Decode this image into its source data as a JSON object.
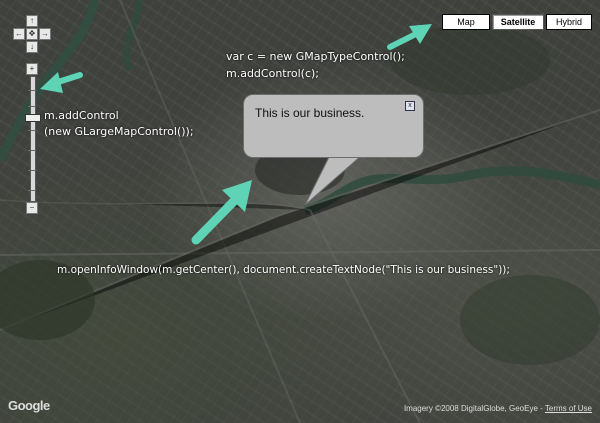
{
  "map_type_control": {
    "map_label": "Map",
    "satellite_label": "Satellite",
    "hybrid_label": "Hybrid",
    "selected": "Satellite"
  },
  "nav_control": {
    "pan_up": "↑",
    "pan_left": "←",
    "pan_center": "✥",
    "pan_right": "→",
    "pan_down": "↓",
    "zoom_in": "+",
    "zoom_out": "−"
  },
  "info_window": {
    "text": "This is our business.",
    "close_symbol": "x"
  },
  "annotations": {
    "maptype_code_line1": "var c = new GMapTypeControl();",
    "maptype_code_line2": "m.addControl(c);",
    "large_control_code_line1": "m.addControl",
    "large_control_code_line2": "(new GLargeMapControl());",
    "info_window_code": "m.openInfoWindow(m.getCenter(), document.createTextNode(\"This is our business\"));"
  },
  "footer": {
    "logo": "Google",
    "imagery_credit": "Imagery ©2008 DigitalGlobe, GeoEye -",
    "terms_link": "Terms of Use"
  },
  "colors": {
    "arrow": "#5fd3b5",
    "info_bg": "#bdbdbd",
    "map_base": "#3f413d"
  },
  "icons": {
    "close": "close-icon",
    "pan_center": "pan-center-icon"
  }
}
